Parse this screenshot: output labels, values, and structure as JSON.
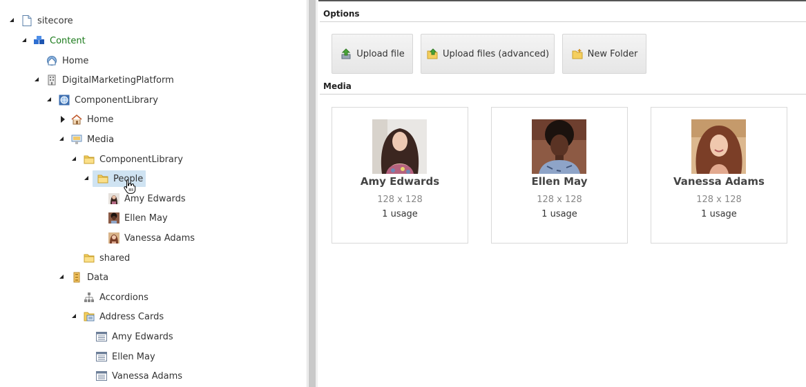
{
  "tree": {
    "items": [
      {
        "label": "sitecore",
        "icon": "document-icon",
        "arrow": "expanded"
      },
      {
        "label": "Content",
        "icon": "content-cubes-icon",
        "arrow": "expanded"
      },
      {
        "label": "Home",
        "icon": "home-globe-icon",
        "arrow": "none"
      },
      {
        "label": "DigitalMarketingPlatform",
        "icon": "building-icon",
        "arrow": "expanded"
      },
      {
        "label": "ComponentLibrary",
        "icon": "site-globe-icon",
        "arrow": "expanded"
      },
      {
        "label": "Home",
        "icon": "house-icon",
        "arrow": "collapsed"
      },
      {
        "label": "Media",
        "icon": "media-folder-icon",
        "arrow": "expanded"
      },
      {
        "label": "ComponentLibrary",
        "icon": "folder-icon",
        "arrow": "expanded"
      },
      {
        "label": "People",
        "icon": "folder-icon",
        "arrow": "expanded"
      },
      {
        "label": "Amy Edwards",
        "icon": "person-thumb-icon",
        "arrow": "none"
      },
      {
        "label": "Ellen May",
        "icon": "person-thumb-icon",
        "arrow": "none"
      },
      {
        "label": "Vanessa Adams",
        "icon": "person-thumb-icon",
        "arrow": "none"
      },
      {
        "label": "shared",
        "icon": "folder-icon",
        "arrow": "none"
      },
      {
        "label": "Data",
        "icon": "data-icon",
        "arrow": "expanded"
      },
      {
        "label": "Accordions",
        "icon": "hierarchy-icon",
        "arrow": "none"
      },
      {
        "label": "Address Cards",
        "icon": "card-folder-icon",
        "arrow": "expanded"
      },
      {
        "label": "Amy Edwards",
        "icon": "table-icon",
        "arrow": "none"
      },
      {
        "label": "Ellen May",
        "icon": "table-icon",
        "arrow": "none"
      },
      {
        "label": "Vanessa Adams",
        "icon": "table-icon",
        "arrow": "none"
      }
    ],
    "selected_index": 8
  },
  "options": {
    "title": "Options",
    "buttons": {
      "upload_file": "Upload file",
      "upload_advanced": "Upload files (advanced)",
      "new_folder": "New Folder"
    }
  },
  "media": {
    "title": "Media",
    "cards": [
      {
        "name": "Amy Edwards",
        "dimensions": "128 x 128",
        "usage": "1 usage"
      },
      {
        "name": "Ellen May",
        "dimensions": "128 x 128",
        "usage": "1 usage"
      },
      {
        "name": "Vanessa Adams",
        "dimensions": "128 x 128",
        "usage": "1 usage"
      }
    ]
  },
  "colors": {
    "selected_bg": "#cfe3f2",
    "content_label": "#1a7a1a",
    "button_bg": "#eeeeee"
  }
}
